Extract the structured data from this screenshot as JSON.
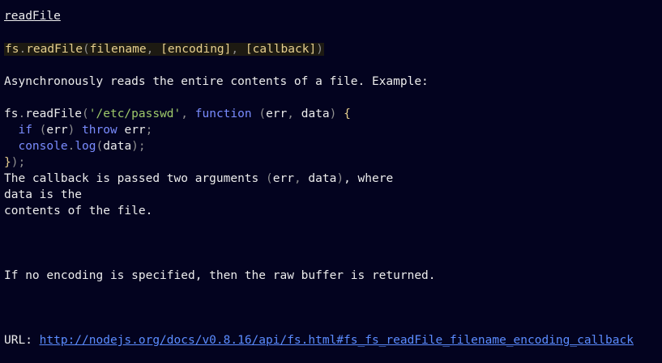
{
  "doc": {
    "title": "readFile",
    "signature": {
      "obj": "fs",
      "dot": ".",
      "method": "readFile",
      "open": "(",
      "arg1": "filename",
      "sep1": ", ",
      "arg2": "[encoding]",
      "sep2": ", ",
      "arg3": "[callback]",
      "close": ")"
    },
    "description": "Asynchronously reads the entire contents of a file. Example:",
    "code": {
      "l1": {
        "obj": "fs",
        "dot": ".",
        "method": "readFile",
        "open": "(",
        "str": "'/etc/passwd'",
        "comma": ", ",
        "kw": "function",
        "sp": " ",
        "po": "(",
        "a1": "err",
        "c2": ", ",
        "a2": "data",
        "pc": ")",
        "sp2": " ",
        "brace": "{"
      },
      "l2": {
        "indent": "  ",
        "kw1": "if",
        "sp": " ",
        "po": "(",
        "v": "err",
        "pc": ")",
        "sp2": " ",
        "kw2": "throw",
        "sp3": " ",
        "v2": "err",
        "semi": ";"
      },
      "l3": {
        "indent": "  ",
        "obj": "console",
        "dot": ".",
        "method": "log",
        "po": "(",
        "v": "data",
        "pc": ")",
        "semi": ";"
      },
      "l4": {
        "brace": "}",
        "rest": ");"
      }
    },
    "callback_note": {
      "l1a": "The callback is passed two arguments ",
      "l1b": "(",
      "l1c": "err",
      "l1d": ", ",
      "l1e": "data",
      "l1f": ")",
      "l1g": ", where",
      "l2": "data is the",
      "l3": "contents of the file."
    },
    "encoding_note": "If no encoding is specified, then the raw buffer is returned.",
    "url_label": "URL: ",
    "url": "http://nodejs.org/docs/v0.8.16/api/fs.html#fs_fs_readFile_filename_encoding_callback"
  },
  "colors": {
    "background": "#03031f",
    "text": "#ececec",
    "function": "#e6cf8e",
    "punctuation": "#8f8f8f",
    "string": "#9ec96a",
    "keyword": "#7a8cff",
    "link": "#5b8cff"
  }
}
